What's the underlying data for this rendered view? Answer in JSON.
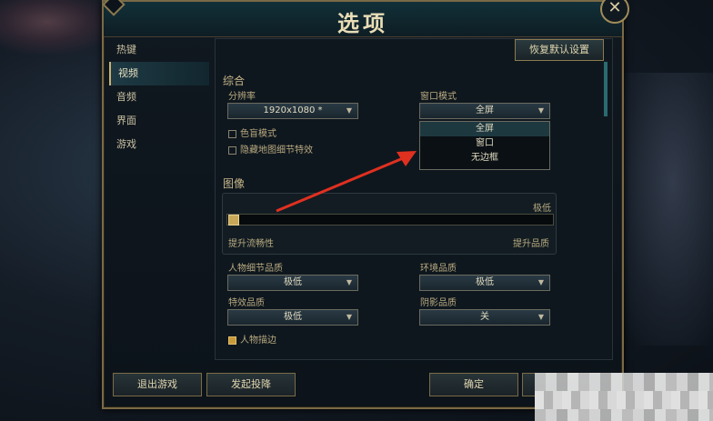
{
  "window": {
    "title": "选项",
    "close_glyph": "✕"
  },
  "sidebar": {
    "items": [
      {
        "label": "热键",
        "active": false
      },
      {
        "label": "视频",
        "active": true
      },
      {
        "label": "音频",
        "active": false
      },
      {
        "label": "界面",
        "active": false
      },
      {
        "label": "游戏",
        "active": false
      }
    ]
  },
  "toolbar": {
    "reset_label": "恢复默认设置"
  },
  "general": {
    "section_title": "综合",
    "resolution_label": "分辨率",
    "resolution_value": "1920x1080 *",
    "window_mode_label": "窗口模式",
    "window_mode_value": "全屏",
    "window_mode_options": [
      "全屏",
      "窗口",
      "无边框"
    ],
    "colorblind_label": "色盲模式",
    "hide_map_detail_label": "隐藏地图细节特效"
  },
  "graphics": {
    "section_title": "图像",
    "quality_top_label": "极低",
    "left_caption": "提升流畅性",
    "right_caption": "提升品质",
    "slider_level": 0.0
  },
  "details": {
    "character_quality_label": "人物细节品质",
    "character_quality_value": "极低",
    "environment_quality_label": "环境品质",
    "environment_quality_value": "极低",
    "effects_quality_label": "特效品质",
    "effects_quality_value": "极低",
    "shadow_quality_label": "阴影品质",
    "shadow_quality_value": "关",
    "character_outline_label": "人物描边"
  },
  "footer": {
    "exit_label": "退出游戏",
    "surrender_label": "发起投降",
    "ok_label": "确定"
  },
  "colors": {
    "accent_gold": "#c8b070",
    "annotation_red": "#e03020"
  }
}
